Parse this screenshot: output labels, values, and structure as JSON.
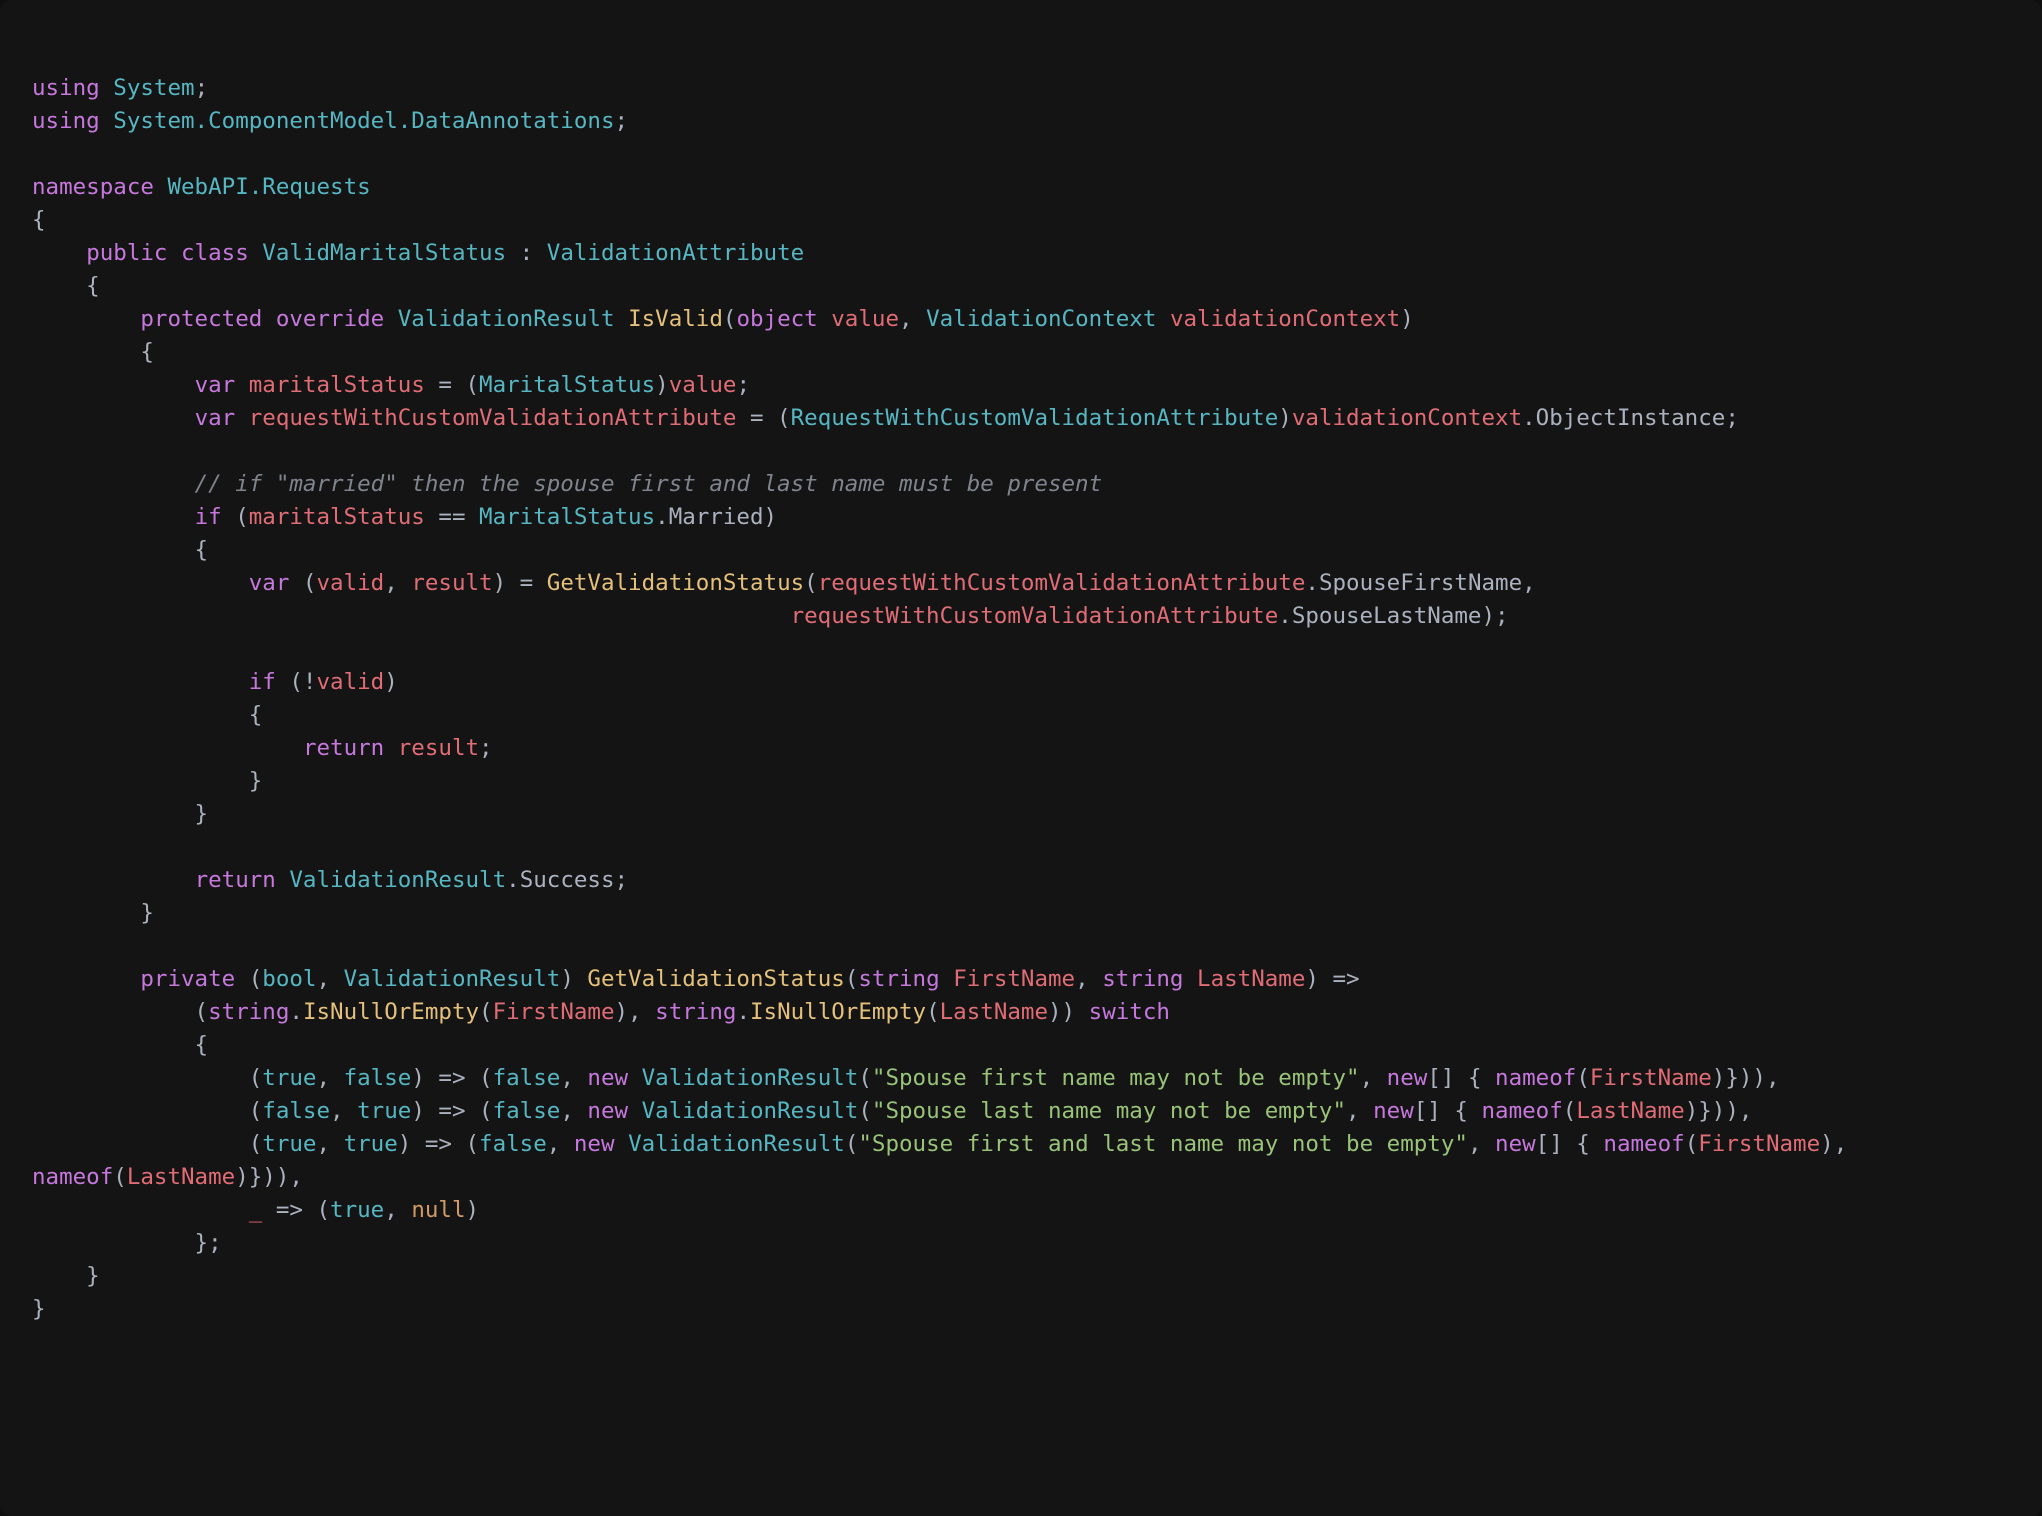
{
  "colors": {
    "background": "#141414",
    "keyword": "#c678dd",
    "type": "#56b6c2",
    "function": "#e5c07b",
    "identifier": "#e06c75",
    "string": "#98c379",
    "comment": "#7f848e",
    "operator": "#abb2bf",
    "constant": "#d19a66"
  },
  "code": {
    "l1": {
      "using": "using",
      "sp": " ",
      "System": "System",
      "semi": ";"
    },
    "l2": {
      "using": "using",
      "sp": " ",
      "ns": "System.ComponentModel.DataAnnotations",
      "semi": ";"
    },
    "l3": "",
    "l4": {
      "namespace": "namespace",
      "sp": " ",
      "name": "WebAPI.Requests"
    },
    "l5": "{",
    "l6": {
      "indent": "    ",
      "public": "public",
      "sp": " ",
      "class": "class",
      "sp2": " ",
      "name": "ValidMaritalStatus",
      "colon": " : ",
      "base": "ValidationAttribute"
    },
    "l7": "    {",
    "l8": {
      "indent": "        ",
      "protected": "protected",
      "sp": " ",
      "override": "override",
      "sp2": " ",
      "ret": "ValidationResult",
      "sp3": " ",
      "fn": "IsValid",
      "op1": "(",
      "object": "object",
      "sp4": " ",
      "p1": "value",
      "comma": ", ",
      "ctx": "ValidationContext",
      "sp5": " ",
      "p2": "validationContext",
      "op2": ")"
    },
    "l9": "        {",
    "l10": {
      "indent": "            ",
      "var": "var",
      "sp": " ",
      "name": "maritalStatus",
      "eq": " = (",
      "cast": "MaritalStatus",
      "close": ")",
      "src": "value",
      "semi": ";"
    },
    "l11": {
      "indent": "            ",
      "var": "var",
      "sp": " ",
      "name": "requestWithCustomValidationAttribute",
      "eq": " = (",
      "cast": "RequestWithCustomValidationAttribute",
      "close": ")",
      "src": "validationContext",
      "dot": ".",
      "prop": "ObjectInstance",
      "semi": ";"
    },
    "l12": "",
    "l13": {
      "indent": "            ",
      "comment": "// if \"married\" then the spouse first and last name must be present"
    },
    "l14": {
      "indent": "            ",
      "if": "if",
      "open": " (",
      "lhs": "maritalStatus",
      "eq": " == ",
      "rhs1": "MaritalStatus",
      "dot": ".",
      "rhs2": "Married",
      "close": ")"
    },
    "l15": "            {",
    "l16": {
      "indent": "                ",
      "var": "var",
      "open": " (",
      "v1": "valid",
      "comma": ", ",
      "v2": "result",
      "close": ") = ",
      "fn": "GetValidationStatus",
      "open2": "(",
      "a1": "requestWithCustomValidationAttribute",
      "dot1": ".",
      "p1": "SpouseFirstName",
      "comma2": ","
    },
    "l17": {
      "indent": "                                                        ",
      "a1": "requestWithCustomValidationAttribute",
      "dot1": ".",
      "p1": "SpouseLastName",
      "close": ");"
    },
    "l18": "",
    "l19": {
      "indent": "                ",
      "if": "if",
      "open": " (!",
      "v": "valid",
      "close": ")"
    },
    "l20": "                {",
    "l21": {
      "indent": "                    ",
      "return": "return",
      "sp": " ",
      "v": "result",
      "semi": ";"
    },
    "l22": "                }",
    "l23": "            }",
    "l24": "",
    "l25": {
      "indent": "            ",
      "return": "return",
      "sp": " ",
      "cls": "ValidationResult",
      "dot": ".",
      "prop": "Success",
      "semi": ";"
    },
    "l26": "        }",
    "l27": "",
    "l28": {
      "indent": "        ",
      "private": "private",
      "open": " (",
      "bool": "bool",
      "comma": ", ",
      "vr": "ValidationResult",
      "close": ") ",
      "fn": "GetValidationStatus",
      "open2": "(",
      "string1": "string",
      "sp": " ",
      "p1": "FirstName",
      "comma2": ", ",
      "string2": "string",
      "sp2": " ",
      "p2": "LastName",
      "close2": ") =>"
    },
    "l29": {
      "indent": "            (",
      "string1": "string",
      "dot1": ".",
      "m1": "IsNullOrEmpty",
      "open1": "(",
      "a1": "FirstName",
      "close1": "), ",
      "string2": "string",
      "dot2": ".",
      "m2": "IsNullOrEmpty",
      "open2": "(",
      "a2": "LastName",
      "close2": ")) ",
      "switch": "switch"
    },
    "l30": "            {",
    "l31": {
      "indent": "                (",
      "t1": "true",
      "comma": ", ",
      "t2": "false",
      "close": ") => (",
      "r1": "false",
      "comma2": ", ",
      "new": "new",
      "sp": " ",
      "vr": "ValidationResult",
      "open": "(",
      "str": "\"Spouse first name may not be empty\"",
      "comma3": ", ",
      "new2": "new",
      "arr": "[] { ",
      "nameof": "nameof",
      "open2": "(",
      "arg": "FirstName",
      "close2": ")})),"
    },
    "l32": {
      "indent": "                (",
      "t1": "false",
      "comma": ", ",
      "t2": "true",
      "close": ") => (",
      "r1": "false",
      "comma2": ", ",
      "new": "new",
      "sp": " ",
      "vr": "ValidationResult",
      "open": "(",
      "str": "\"Spouse last name may not be empty\"",
      "comma3": ", ",
      "new2": "new",
      "arr": "[] { ",
      "nameof": "nameof",
      "open2": "(",
      "arg": "LastName",
      "close2": ")})),"
    },
    "l33a": {
      "indent": "                (",
      "t1": "true",
      "comma": ", ",
      "t2": "true",
      "close": ") => (",
      "r1": "false",
      "comma2": ", ",
      "new": "new",
      "sp": " ",
      "vr": "ValidationResult",
      "open": "(",
      "str": "\"Spouse first and last name may not be empty\"",
      "comma3": ", ",
      "new2": "new",
      "arr": "[] { ",
      "nameof": "nameof",
      "open2": "(",
      "arg": "FirstName",
      "close2": "), "
    },
    "l33b": {
      "nameof": "nameof",
      "open": "(",
      "arg": "LastName",
      "close": ")})),"
    },
    "l34": {
      "indent": "                ",
      "us": "_",
      "arrow": " => (",
      "t": "true",
      "comma": ", ",
      "n": "null",
      "close": ")"
    },
    "l35": "            };",
    "l36": "    }",
    "l37": "}"
  }
}
